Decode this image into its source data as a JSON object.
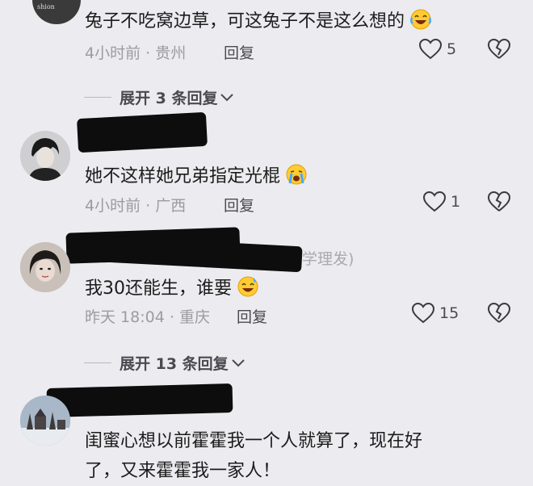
{
  "comments": [
    {
      "text": "兔子不吃窝边草，可这兔子不是这么想的",
      "emoji": "laughing-crying-emoji",
      "time": "4小时前",
      "sep": "·",
      "region": "贵州",
      "reply_label": "回复",
      "likes": "5"
    },
    {
      "text": "她不这样她兄弟指定光棍",
      "emoji": "crying-emoji",
      "time": "4小时前",
      "sep": "·",
      "region": "广西",
      "reply_label": "回复",
      "likes": "1"
    },
    {
      "author_suffix": "学理发)",
      "text": "我30还能生，谁要",
      "emoji": "sweat-smile-emoji",
      "time": "昨天 18:04",
      "sep": "·",
      "region": "重庆",
      "reply_label": "回复",
      "likes": "15"
    },
    {
      "text_line1": "闺蜜心想以前霍霍我一个人就算了，现在好",
      "text_line2": "了，又来霍霍我一家人！"
    }
  ],
  "expand_replies": [
    {
      "label": "展开 3 条回复"
    },
    {
      "label": "展开 13 条回复"
    }
  ],
  "colors": {
    "background": "#ecebef",
    "text": "#1c1c1c",
    "meta": "#9b9ba3",
    "action": "#4a4a52"
  }
}
